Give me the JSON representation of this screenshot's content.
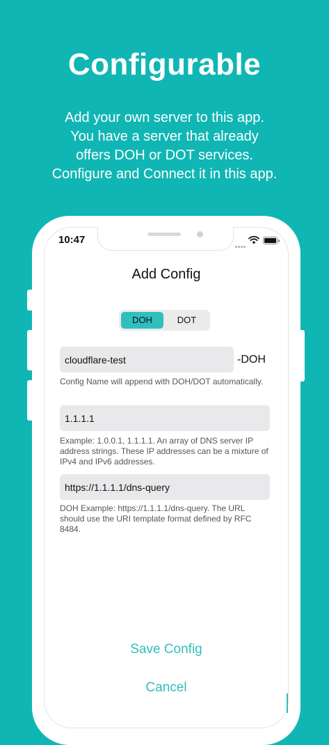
{
  "promo": {
    "headline": "Configurable",
    "description_lines": [
      "Add your own server to this app.",
      "You have a server that already",
      "offers DOH or DOT services.",
      "Configure and Connect it in this app."
    ]
  },
  "status_bar": {
    "time": "10:47"
  },
  "screen": {
    "title": "Add Config",
    "segments": [
      {
        "label": "DOH",
        "selected": true
      },
      {
        "label": "DOT",
        "selected": false
      }
    ],
    "name_field": {
      "value": "cloudflare-test",
      "suffix": "-DOH"
    },
    "name_hint": "Config Name will append with DOH/DOT automatically.",
    "ip_field": {
      "value": "1.1.1.1"
    },
    "ip_hint": "Example: 1.0.0.1, 1.1.1.1. An array of DNS server IP address strings. These IP addresses can be a mixture of IPv4 and IPv6 addresses.",
    "url_field": {
      "value": "https://1.1.1.1/dns-query"
    },
    "url_hint": "DOH Example: https://1.1.1.1/dns-query. The URL should use the URI template format defined by RFC 8484.",
    "save_label": "Save Config",
    "cancel_label": "Cancel"
  },
  "colors": {
    "background": "#10b6b4",
    "accent": "#2fbfbd"
  }
}
